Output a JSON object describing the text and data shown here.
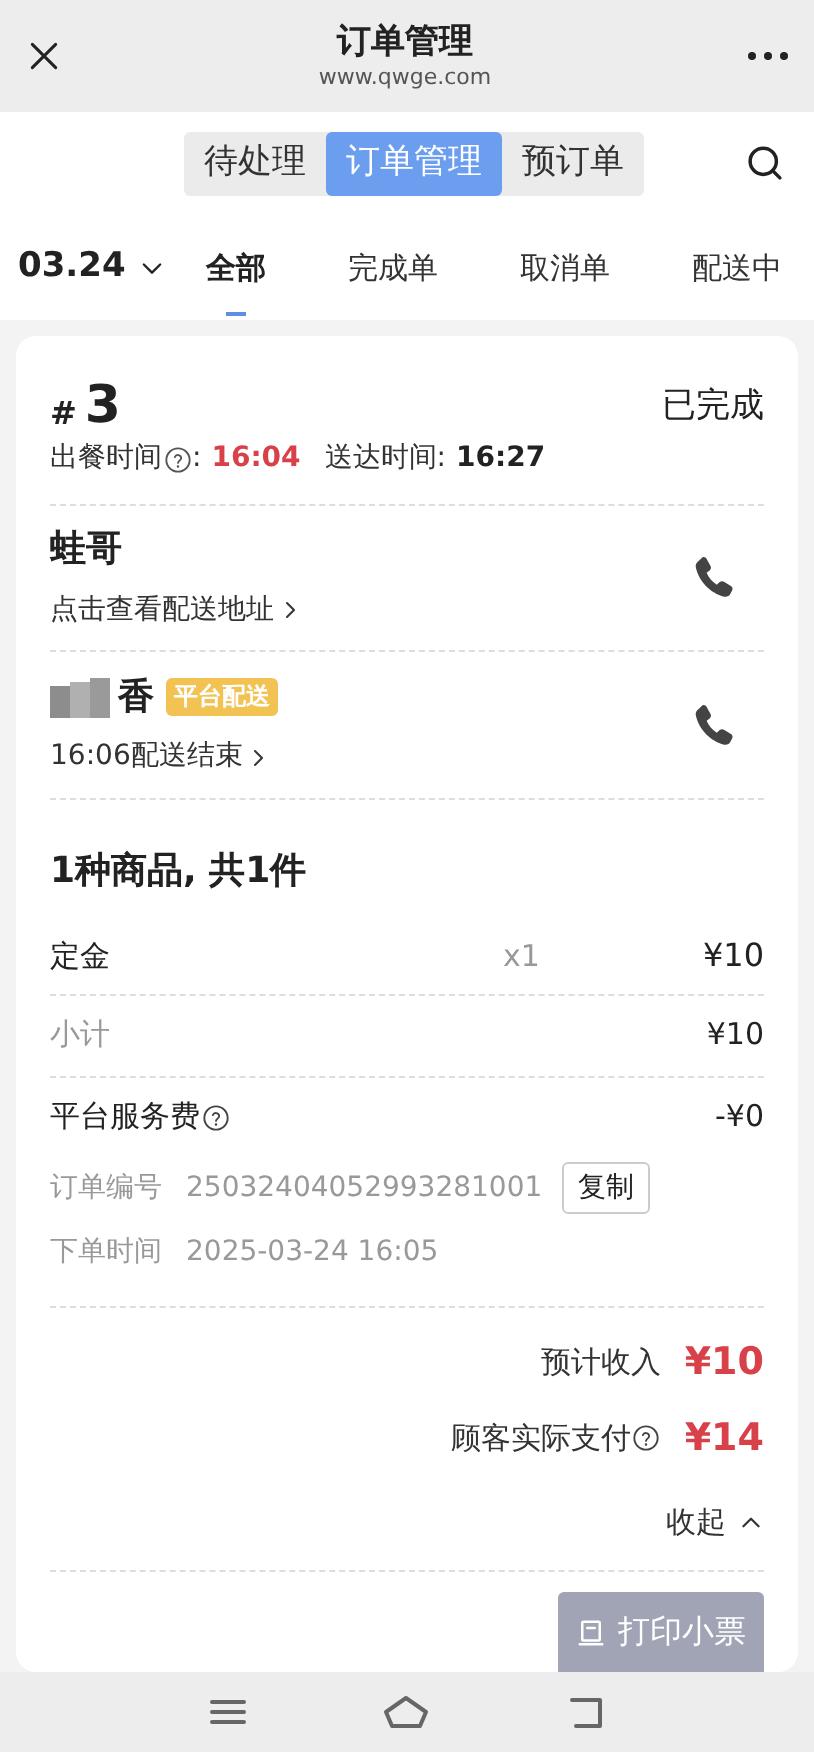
{
  "header": {
    "title": "订单管理",
    "subtitle": "www.qwge.com"
  },
  "segments": [
    {
      "label": "待处理",
      "selected": false
    },
    {
      "label": "订单管理",
      "selected": true
    },
    {
      "label": "预订单",
      "selected": false
    }
  ],
  "date_filter": "03.24",
  "filters": [
    {
      "label": "全部",
      "selected": true
    },
    {
      "label": "完成单",
      "selected": false
    },
    {
      "label": "取消单",
      "selected": false
    },
    {
      "label": "配送中",
      "selected": false
    }
  ],
  "order": {
    "number_prefix": "#",
    "number": "3",
    "status": "已完成",
    "times": [
      {
        "label": "出餐时间",
        "help": true,
        "sep": ":",
        "value": "16:04",
        "highlight": true
      },
      {
        "label": "送达时间",
        "help": false,
        "sep": ":",
        "value": "16:27",
        "highlight": false
      }
    ],
    "customer": {
      "name": "蛙哥",
      "link": "点击查看配送地址"
    },
    "rider": {
      "name": "香",
      "redacted": true,
      "badge": "平台配送",
      "link": "16:06配送结束"
    },
    "goods_title": "1种商品, 共1件",
    "items": [
      {
        "name": "定金",
        "qty": "x1",
        "price": "¥10"
      }
    ],
    "subtotal": {
      "label": "小计",
      "value": "¥10"
    },
    "fee": {
      "label": "平台服务费",
      "help": true,
      "value": "-¥0"
    },
    "details": [
      {
        "label": "订单编号",
        "value": "25032404052993281001",
        "action": "复制"
      },
      {
        "label": "下单时间",
        "value": "2025-03-24 16:05"
      }
    ],
    "totals": [
      {
        "label": "预计收入",
        "help": false,
        "value": "¥10"
      },
      {
        "label": "顾客实际支付",
        "help": true,
        "value": "¥14"
      }
    ],
    "collapse": "收起",
    "print_button": "打印小票"
  }
}
